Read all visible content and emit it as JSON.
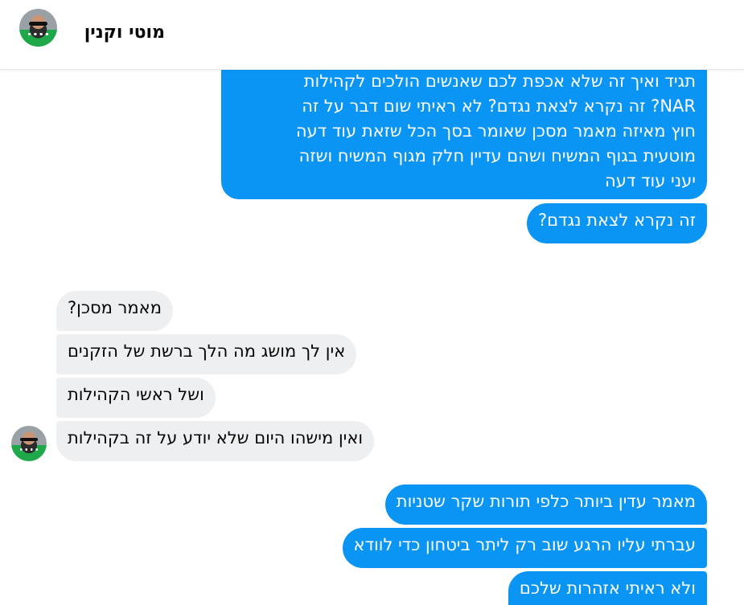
{
  "contact": {
    "name": "מוטי וקנין"
  },
  "messages": [
    {
      "sender": "me",
      "lines": [
        "תגיד ואיך זה שלא אכפת לכם שאנשים הולכים לקהילות",
        "NAR? זה נקרא לצאת נגדם? לא ראיתי שום דבר על זה",
        "חוץ מאיזה מאמר מסכן שאומר בסך הכל שזאת עוד דעה",
        "מוטעית בגוף המשיח ושהם עדיין חלק מגוף המשיח ושזה",
        "יעני עוד דעה"
      ]
    },
    {
      "sender": "me",
      "text": "זה נקרא לצאת נגדם?"
    },
    {
      "sender": "them",
      "text": "מאמר מסכן?"
    },
    {
      "sender": "them",
      "text": "אין לך מושג מה הלך ברשת של הזקנים"
    },
    {
      "sender": "them",
      "text": "ושל ראשי הקהילות"
    },
    {
      "sender": "them",
      "text": "ואין מישהו היום שלא יודע על זה בקהילות"
    },
    {
      "sender": "me",
      "text": "מאמר עדין ביותר כלפי תורות שקר שטניות"
    },
    {
      "sender": "me",
      "text": "עברתי עליו הרגע שוב רק ליתר ביטחון כדי לוודא"
    },
    {
      "sender": "me",
      "text": "ולא ראיתי אזהרות שלכם"
    }
  ],
  "colors": {
    "outgoing_bubble": "#0a95f5",
    "incoming_bubble": "#eeeff1"
  }
}
